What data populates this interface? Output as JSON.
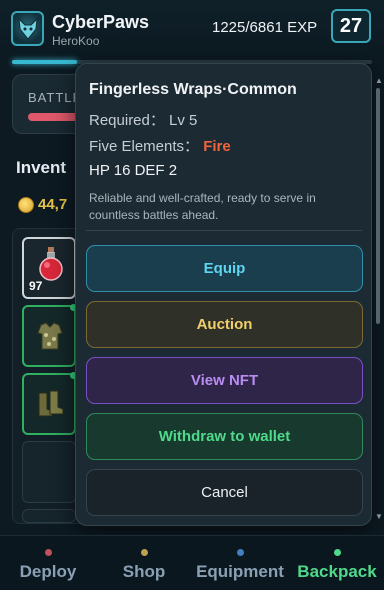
{
  "header": {
    "player_name": "CyberPaws",
    "player_sub": "HeroKoo",
    "exp_text": "1225/6861 EXP",
    "level": "27",
    "exp_progress": 0.18
  },
  "background": {
    "battle_label": "BATTLE",
    "inventory_title": "Invent",
    "coins": "44,7",
    "items": [
      {
        "name": "red-potion",
        "count": "97"
      },
      {
        "name": "armor-vest"
      },
      {
        "name": "combat-boots"
      }
    ]
  },
  "popup": {
    "title": "Fingerless Wraps·Common",
    "required_label": "Required：",
    "required_value": "Lv 5",
    "elements_label": "Five Elements：",
    "elements_value": "Fire",
    "stats": "HP 16 DEF 2",
    "description": "Reliable and well-crafted, ready to serve in countless battles ahead.",
    "buttons": {
      "equip": "Equip",
      "auction": "Auction",
      "view_nft": "View NFT",
      "withdraw": "Withdraw to wallet",
      "cancel": "Cancel"
    }
  },
  "nav": {
    "items": [
      {
        "label": "Deploy",
        "dot_color": "#c0505a"
      },
      {
        "label": "Shop",
        "dot_color": "#c0a050"
      },
      {
        "label": "Equipment",
        "dot_color": "#4080c0"
      },
      {
        "label": "Backpack",
        "dot_color": "#4fd98a"
      }
    ],
    "active": "Backpack"
  },
  "colors": {
    "accent": "#3aa7b8",
    "fire": "#f0643c",
    "active_nav": "#4fd98a"
  }
}
